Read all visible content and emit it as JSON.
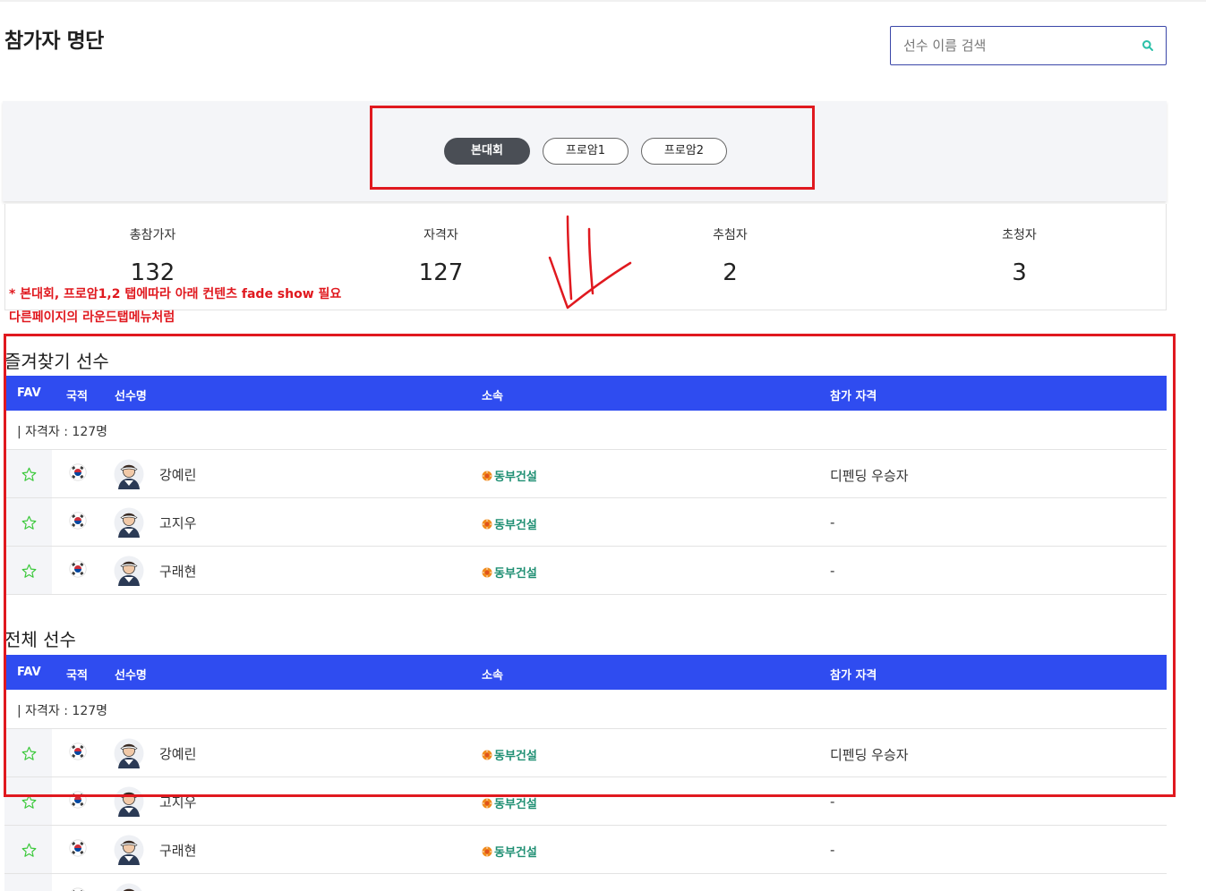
{
  "page": {
    "title": "참가자 명단"
  },
  "search": {
    "placeholder": "선수 이름 검색"
  },
  "tabs": [
    {
      "label": "본대회",
      "active": true
    },
    {
      "label": "프로암1",
      "active": false
    },
    {
      "label": "프로암2",
      "active": false
    }
  ],
  "stats": [
    {
      "label": "총참가자",
      "value": "132"
    },
    {
      "label": "자격자",
      "value": "127"
    },
    {
      "label": "추첨자",
      "value": "2"
    },
    {
      "label": "초청자",
      "value": "3"
    }
  ],
  "annotation": {
    "note_line1": "* 본대회, 프로암1,2 탭에따라 아래 컨텐츠 fade show 필요",
    "note_line2": "다른페이지의 라운드탭메뉴처럼",
    "color": "#e0191f"
  },
  "table_headers": {
    "fav": "FAV",
    "nation": "국적",
    "name": "선수명",
    "affiliation": "소속",
    "qualification": "참가 자격"
  },
  "favorites": {
    "title": "즐겨찾기 선수",
    "count_text": "| 자격자 : 127명",
    "rows": [
      {
        "name": "강예린",
        "nation_icon": "korea-flag-icon",
        "affiliation": "동부건설",
        "qualification": "디펜딩 우승자"
      },
      {
        "name": "고지우",
        "nation_icon": "korea-flag-icon",
        "affiliation": "동부건설",
        "qualification": "-"
      },
      {
        "name": "구래현",
        "nation_icon": "korea-flag-icon",
        "affiliation": "동부건설",
        "qualification": "-"
      }
    ]
  },
  "all_players": {
    "title": "전체 선수",
    "count_text": "| 자격자 : 127명",
    "rows": [
      {
        "name": "강예린",
        "nation_icon": "korea-flag-icon",
        "affiliation": "동부건설",
        "qualification": "디펜딩 우승자"
      },
      {
        "name": "고지우",
        "nation_icon": "korea-flag-icon",
        "affiliation": "동부건설",
        "qualification": "-"
      },
      {
        "name": "구래현",
        "nation_icon": "korea-flag-icon",
        "affiliation": "동부건설",
        "qualification": "-"
      }
    ]
  },
  "colors": {
    "header_blue": "#2f4cf0",
    "active_tab": "#4a4e55",
    "affiliation_green": "#1f8f73",
    "star_green": "#3cc93c"
  }
}
